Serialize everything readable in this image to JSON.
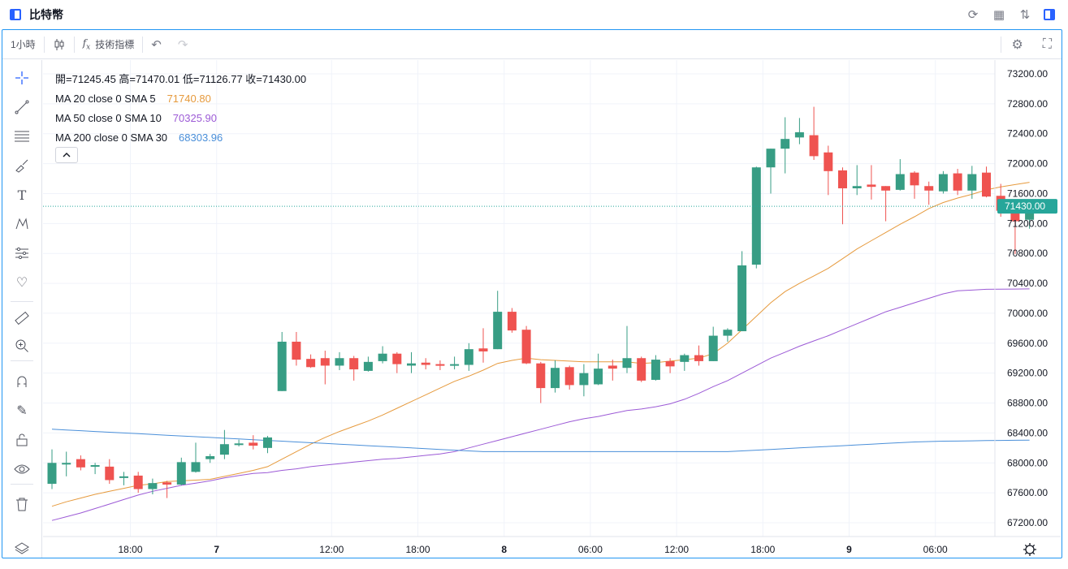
{
  "window": {
    "title": "比特幣"
  },
  "toolbar": {
    "interval": "1小時",
    "indicators_label": "技術指標",
    "indicators_icon": "fx-icon"
  },
  "legend": {
    "ohlc_text": "開=71245.45 高=71470.01 低=71126.77 收=71430.00",
    "ma1_label": "MA 20 close 0 SMA 5",
    "ma1_value": "71740.80",
    "ma2_label": "MA 50 close 0 SMA 10",
    "ma2_value": "70325.90",
    "ma3_label": "MA 200 close 0 SMA 30",
    "ma3_value": "68303.96",
    "collapse_icon": "chevron-up-icon"
  },
  "colors": {
    "up": "#26a69a",
    "up_fill": "#379d84",
    "down": "#ef5350",
    "ma1": "#e69a3d",
    "ma2": "#9c5ad6",
    "ma3": "#4a8fd9",
    "price_label_bg": "#26a69a"
  },
  "chart_data": {
    "type": "candlestick",
    "yticks": [
      "73200.00",
      "72800.00",
      "72400.00",
      "72000.00",
      "71600.00",
      "71200.00",
      "70800.00",
      "70400.00",
      "70000.00",
      "69600.00",
      "69200.00",
      "68800.00",
      "68400.00",
      "68000.00",
      "67600.00",
      "67200.00"
    ],
    "ylim": [
      67000,
      73400
    ],
    "x_labels": [
      {
        "i": 5,
        "label": "18:00",
        "bold": false
      },
      {
        "i": 11,
        "label": "7",
        "bold": true
      },
      {
        "i": 19,
        "label": "12:00",
        "bold": false
      },
      {
        "i": 25,
        "label": "18:00",
        "bold": false
      },
      {
        "i": 31,
        "label": "8",
        "bold": true
      },
      {
        "i": 37,
        "label": "06:00",
        "bold": false
      },
      {
        "i": 43,
        "label": "12:00",
        "bold": false
      },
      {
        "i": 49,
        "label": "18:00",
        "bold": false
      },
      {
        "i": 55,
        "label": "9",
        "bold": true
      },
      {
        "i": 61,
        "label": "06:00",
        "bold": false
      }
    ],
    "last_price": "71430.00",
    "last_price_value": 71430,
    "candles": [
      [
        67720,
        68000,
        67650,
        68180
      ],
      [
        68000,
        68000,
        67820,
        68150
      ],
      [
        68050,
        67940,
        67900,
        68100
      ],
      [
        67950,
        67970,
        67850,
        68000
      ],
      [
        67950,
        67770,
        67720,
        68050
      ],
      [
        67800,
        67820,
        67700,
        67880
      ],
      [
        67830,
        67650,
        67600,
        67880
      ],
      [
        67650,
        67730,
        67580,
        67790
      ],
      [
        67740,
        67710,
        67530,
        67760
      ],
      [
        67710,
        68010,
        67700,
        68070
      ],
      [
        67880,
        68010,
        67870,
        68270
      ],
      [
        68050,
        68090,
        68000,
        68120
      ],
      [
        68110,
        68250,
        68050,
        68440
      ],
      [
        68260,
        68260,
        68220,
        68310
      ],
      [
        68270,
        68230,
        68180,
        68370
      ],
      [
        68200,
        68340,
        68130,
        68360
      ],
      [
        68960,
        69620,
        68960,
        69750
      ],
      [
        69620,
        69380,
        69300,
        69750
      ],
      [
        69390,
        69280,
        69270,
        69450
      ],
      [
        69400,
        69300,
        69050,
        69500
      ],
      [
        69300,
        69400,
        69240,
        69480
      ],
      [
        69400,
        69250,
        69100,
        69430
      ],
      [
        69230,
        69350,
        69220,
        69420
      ],
      [
        69360,
        69460,
        69330,
        69560
      ],
      [
        69460,
        69320,
        69200,
        69480
      ],
      [
        69300,
        69330,
        69200,
        69480
      ],
      [
        69340,
        69310,
        69250,
        69400
      ],
      [
        69320,
        69300,
        69240,
        69370
      ],
      [
        69300,
        69320,
        69250,
        69420
      ],
      [
        69310,
        69520,
        69230,
        69600
      ],
      [
        69530,
        69490,
        69340,
        69800
      ],
      [
        69520,
        70020,
        69520,
        70300
      ],
      [
        70020,
        69770,
        69740,
        70070
      ],
      [
        69780,
        69330,
        69320,
        69830
      ],
      [
        69330,
        69000,
        68800,
        69350
      ],
      [
        69000,
        69270,
        68940,
        69370
      ],
      [
        69280,
        69040,
        68980,
        69300
      ],
      [
        69040,
        69200,
        68890,
        69320
      ],
      [
        69050,
        69260,
        69040,
        69460
      ],
      [
        69300,
        69260,
        69100,
        69380
      ],
      [
        69270,
        69400,
        69200,
        69830
      ],
      [
        69400,
        69100,
        69080,
        69420
      ],
      [
        69110,
        69380,
        69100,
        69440
      ],
      [
        69360,
        69290,
        69200,
        69400
      ],
      [
        69350,
        69440,
        69230,
        69460
      ],
      [
        69440,
        69360,
        69300,
        69570
      ],
      [
        69360,
        69700,
        69360,
        69820
      ],
      [
        69700,
        69780,
        69620,
        69800
      ],
      [
        69760,
        70640,
        69760,
        70830
      ],
      [
        70650,
        71950,
        70600,
        71960
      ],
      [
        71950,
        72200,
        71600,
        72200
      ],
      [
        72200,
        72330,
        71870,
        72620
      ],
      [
        72350,
        72420,
        72260,
        72610
      ],
      [
        72380,
        72100,
        72050,
        72760
      ],
      [
        72150,
        71900,
        71580,
        72240
      ],
      [
        71910,
        71670,
        71190,
        71950
      ],
      [
        71670,
        71700,
        71580,
        71980
      ],
      [
        71720,
        71690,
        71520,
        71980
      ],
      [
        71700,
        71640,
        71230,
        71700
      ],
      [
        71650,
        71860,
        71640,
        72060
      ],
      [
        71880,
        71710,
        71530,
        71900
      ],
      [
        71700,
        71640,
        71450,
        71760
      ],
      [
        71630,
        71860,
        71600,
        71900
      ],
      [
        71870,
        71640,
        71580,
        71930
      ],
      [
        71640,
        71860,
        71530,
        71970
      ],
      [
        71880,
        71560,
        71550,
        71960
      ],
      [
        71570,
        71370,
        71290,
        71730
      ],
      [
        71400,
        71230,
        70790,
        71410
      ],
      [
        71250,
        71430,
        71130,
        71470
      ]
    ],
    "ma_series": [
      {
        "name": "MA 20 close 0 SMA 5",
        "color": "#e69a3d",
        "values": [
          67420,
          67480,
          67530,
          67580,
          67620,
          67660,
          67700,
          67720,
          67750,
          67760,
          67770,
          67780,
          67820,
          67860,
          67900,
          67950,
          68050,
          68150,
          68250,
          68340,
          68420,
          68490,
          68560,
          68640,
          68730,
          68820,
          68910,
          69000,
          69090,
          69160,
          69240,
          69330,
          69370,
          69400,
          69380,
          69370,
          69360,
          69350,
          69350,
          69350,
          69350,
          69330,
          69340,
          69360,
          69380,
          69400,
          69460,
          69600,
          69780,
          69960,
          70140,
          70290,
          70400,
          70500,
          70600,
          70730,
          70860,
          70970,
          71080,
          71190,
          71290,
          71400,
          71480,
          71540,
          71590,
          71650,
          71690,
          71720,
          71750
        ]
      },
      {
        "name": "MA 50 close 0 SMA 10",
        "color": "#9c5ad6",
        "values": [
          67230,
          67280,
          67330,
          67390,
          67450,
          67510,
          67570,
          67620,
          67660,
          67700,
          67730,
          67760,
          67800,
          67830,
          67860,
          67870,
          67900,
          67920,
          67950,
          67970,
          67990,
          68010,
          68030,
          68050,
          68060,
          68080,
          68100,
          68120,
          68150,
          68200,
          68250,
          68300,
          68350,
          68400,
          68450,
          68500,
          68550,
          68590,
          68620,
          68660,
          68700,
          68720,
          68750,
          68790,
          68850,
          68930,
          69020,
          69100,
          69200,
          69300,
          69400,
          69480,
          69560,
          69630,
          69700,
          69780,
          69860,
          69940,
          70020,
          70080,
          70140,
          70200,
          70260,
          70300,
          70310,
          70320,
          70322,
          70324,
          70326
        ]
      },
      {
        "name": "MA 200 close 0 SMA 30",
        "color": "#4a8fd9",
        "values": [
          68450,
          68440,
          68430,
          68420,
          68410,
          68400,
          68390,
          68380,
          68370,
          68360,
          68350,
          68340,
          68330,
          68320,
          68310,
          68300,
          68290,
          68280,
          68270,
          68260,
          68250,
          68240,
          68230,
          68220,
          68210,
          68200,
          68190,
          68180,
          68170,
          68160,
          68150,
          68150,
          68150,
          68150,
          68150,
          68150,
          68150,
          68150,
          68150,
          68150,
          68150,
          68150,
          68150,
          68150,
          68150,
          68150,
          68150,
          68150,
          68160,
          68170,
          68180,
          68190,
          68200,
          68210,
          68220,
          68230,
          68240,
          68250,
          68260,
          68270,
          68280,
          68285,
          68290,
          68292,
          68295,
          68298,
          68300,
          68302,
          68304
        ]
      }
    ]
  }
}
